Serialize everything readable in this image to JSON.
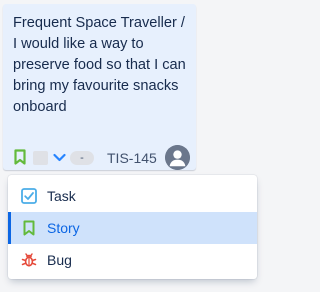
{
  "card": {
    "summary": "Frequent Space Traveller / I would like a way to preserve food so that I can bring my favourite snacks onboard",
    "issue_type_icon": "story-bookmark-icon",
    "priority_icon": "priority-low-chevron-icon",
    "estimate": "-",
    "issue_key": "TIS-145",
    "assignee_icon": "default-user-avatar-icon"
  },
  "issue_type_menu": {
    "items": [
      {
        "label": "Task",
        "icon": "task-checkbox-icon",
        "selected": false
      },
      {
        "label": "Story",
        "icon": "story-bookmark-icon",
        "selected": true
      },
      {
        "label": "Bug",
        "icon": "bug-icon",
        "selected": false
      }
    ]
  },
  "colors": {
    "card_background": "#e7f0fd",
    "story_green": "#63ba3c",
    "task_blue": "#4bade8",
    "bug_red": "#e5493a",
    "selected_background": "#cfe2fb",
    "selected_accent": "#0c66e4",
    "priority_blue": "#2684ff"
  }
}
